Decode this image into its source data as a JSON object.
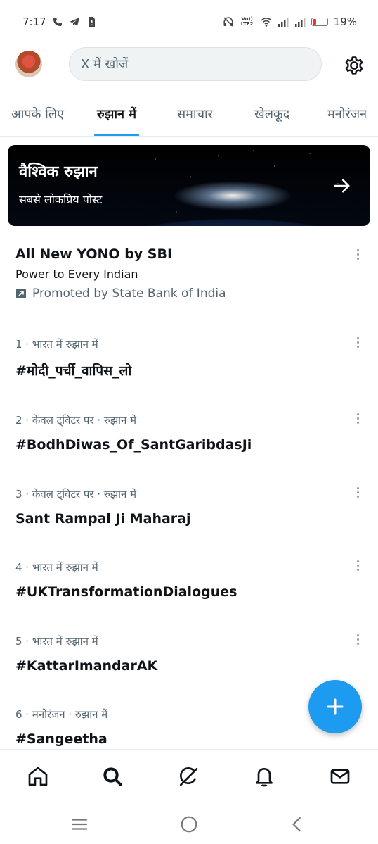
{
  "status_bar": {
    "time": "7:17",
    "battery": "19%",
    "volte": "Vo)) LTE2",
    "battery_level": 0.19
  },
  "search": {
    "placeholder": "X में खोजें"
  },
  "tabs": [
    {
      "label": "आपके लिए",
      "active": false
    },
    {
      "label": "रुझान में",
      "active": true
    },
    {
      "label": "समाचार",
      "active": false
    },
    {
      "label": "खेलकूद",
      "active": false
    },
    {
      "label": "मनोरंजन",
      "active": false
    }
  ],
  "banner": {
    "title": "वैश्विक रुझान",
    "subtitle": "सबसे लोकप्रिय पोस्ट"
  },
  "promo": {
    "title": "All New YONO by SBI",
    "subtitle": "Power to Every Indian",
    "promoted_by": "Promoted by State Bank of India"
  },
  "trends": [
    {
      "meta": "1 · भारत में रुझान में",
      "name": "#मोदी_पर्ची_वापिस_लो"
    },
    {
      "meta": "2 · केवल ट्विटर पर · रुझान में",
      "name": "#BodhDiwas_Of_SantGaribdasJi"
    },
    {
      "meta": "3 · केवल ट्विटर पर · रुझान में",
      "name": "Sant Rampal Ji Maharaj"
    },
    {
      "meta": "4 · भारत में रुझान में",
      "name": "#UKTransformationDialogues"
    },
    {
      "meta": "5 · भारत में रुझान में",
      "name": "#KattarImandarAK"
    },
    {
      "meta": "6 · मनोरंजन · रुझान में",
      "name": "#Sangeetha"
    }
  ],
  "colors": {
    "accent": "#1d9bf0",
    "text": "#0f1419",
    "muted": "#536471"
  },
  "icons": {
    "nav": [
      "home-icon",
      "search-icon",
      "grok-icon",
      "notifications-icon",
      "messages-icon"
    ],
    "system": [
      "recents-icon",
      "home-circle-icon",
      "back-icon"
    ]
  }
}
